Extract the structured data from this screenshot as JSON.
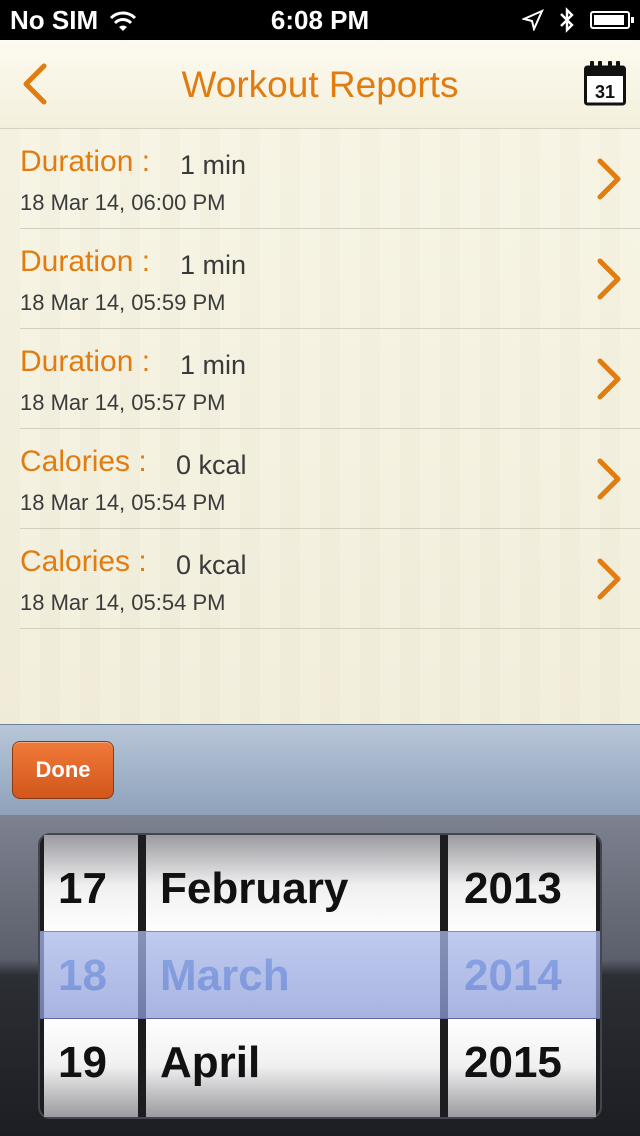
{
  "status_bar": {
    "carrier": "No SIM",
    "time": "6:08 PM"
  },
  "nav": {
    "title": "Workout Reports",
    "calendar_day": "31"
  },
  "reports": [
    {
      "label": "Duration :",
      "value": "1 min",
      "date": "18 Mar 14, 06:00 PM"
    },
    {
      "label": "Duration :",
      "value": "1 min",
      "date": "18 Mar 14, 05:59 PM"
    },
    {
      "label": "Duration :",
      "value": "1 min",
      "date": "18 Mar 14, 05:57 PM"
    },
    {
      "label": "Calories :",
      "value": "0  kcal",
      "date": "18 Mar 14, 05:54 PM"
    },
    {
      "label": "Calories :",
      "value": "0  kcal",
      "date": "18 Mar 14, 05:54 PM"
    }
  ],
  "toolbar": {
    "done_label": "Done"
  },
  "picker": {
    "days": [
      "17",
      "18",
      "19"
    ],
    "months": [
      "February",
      "March",
      "April"
    ],
    "years": [
      "2013",
      "2014",
      "2015"
    ],
    "selected": {
      "day": "18",
      "month": "March",
      "year": "2014"
    }
  },
  "colors": {
    "accent": "#e07c10",
    "picker_selected": "#3b74d6",
    "done_button": "#d2561a"
  }
}
